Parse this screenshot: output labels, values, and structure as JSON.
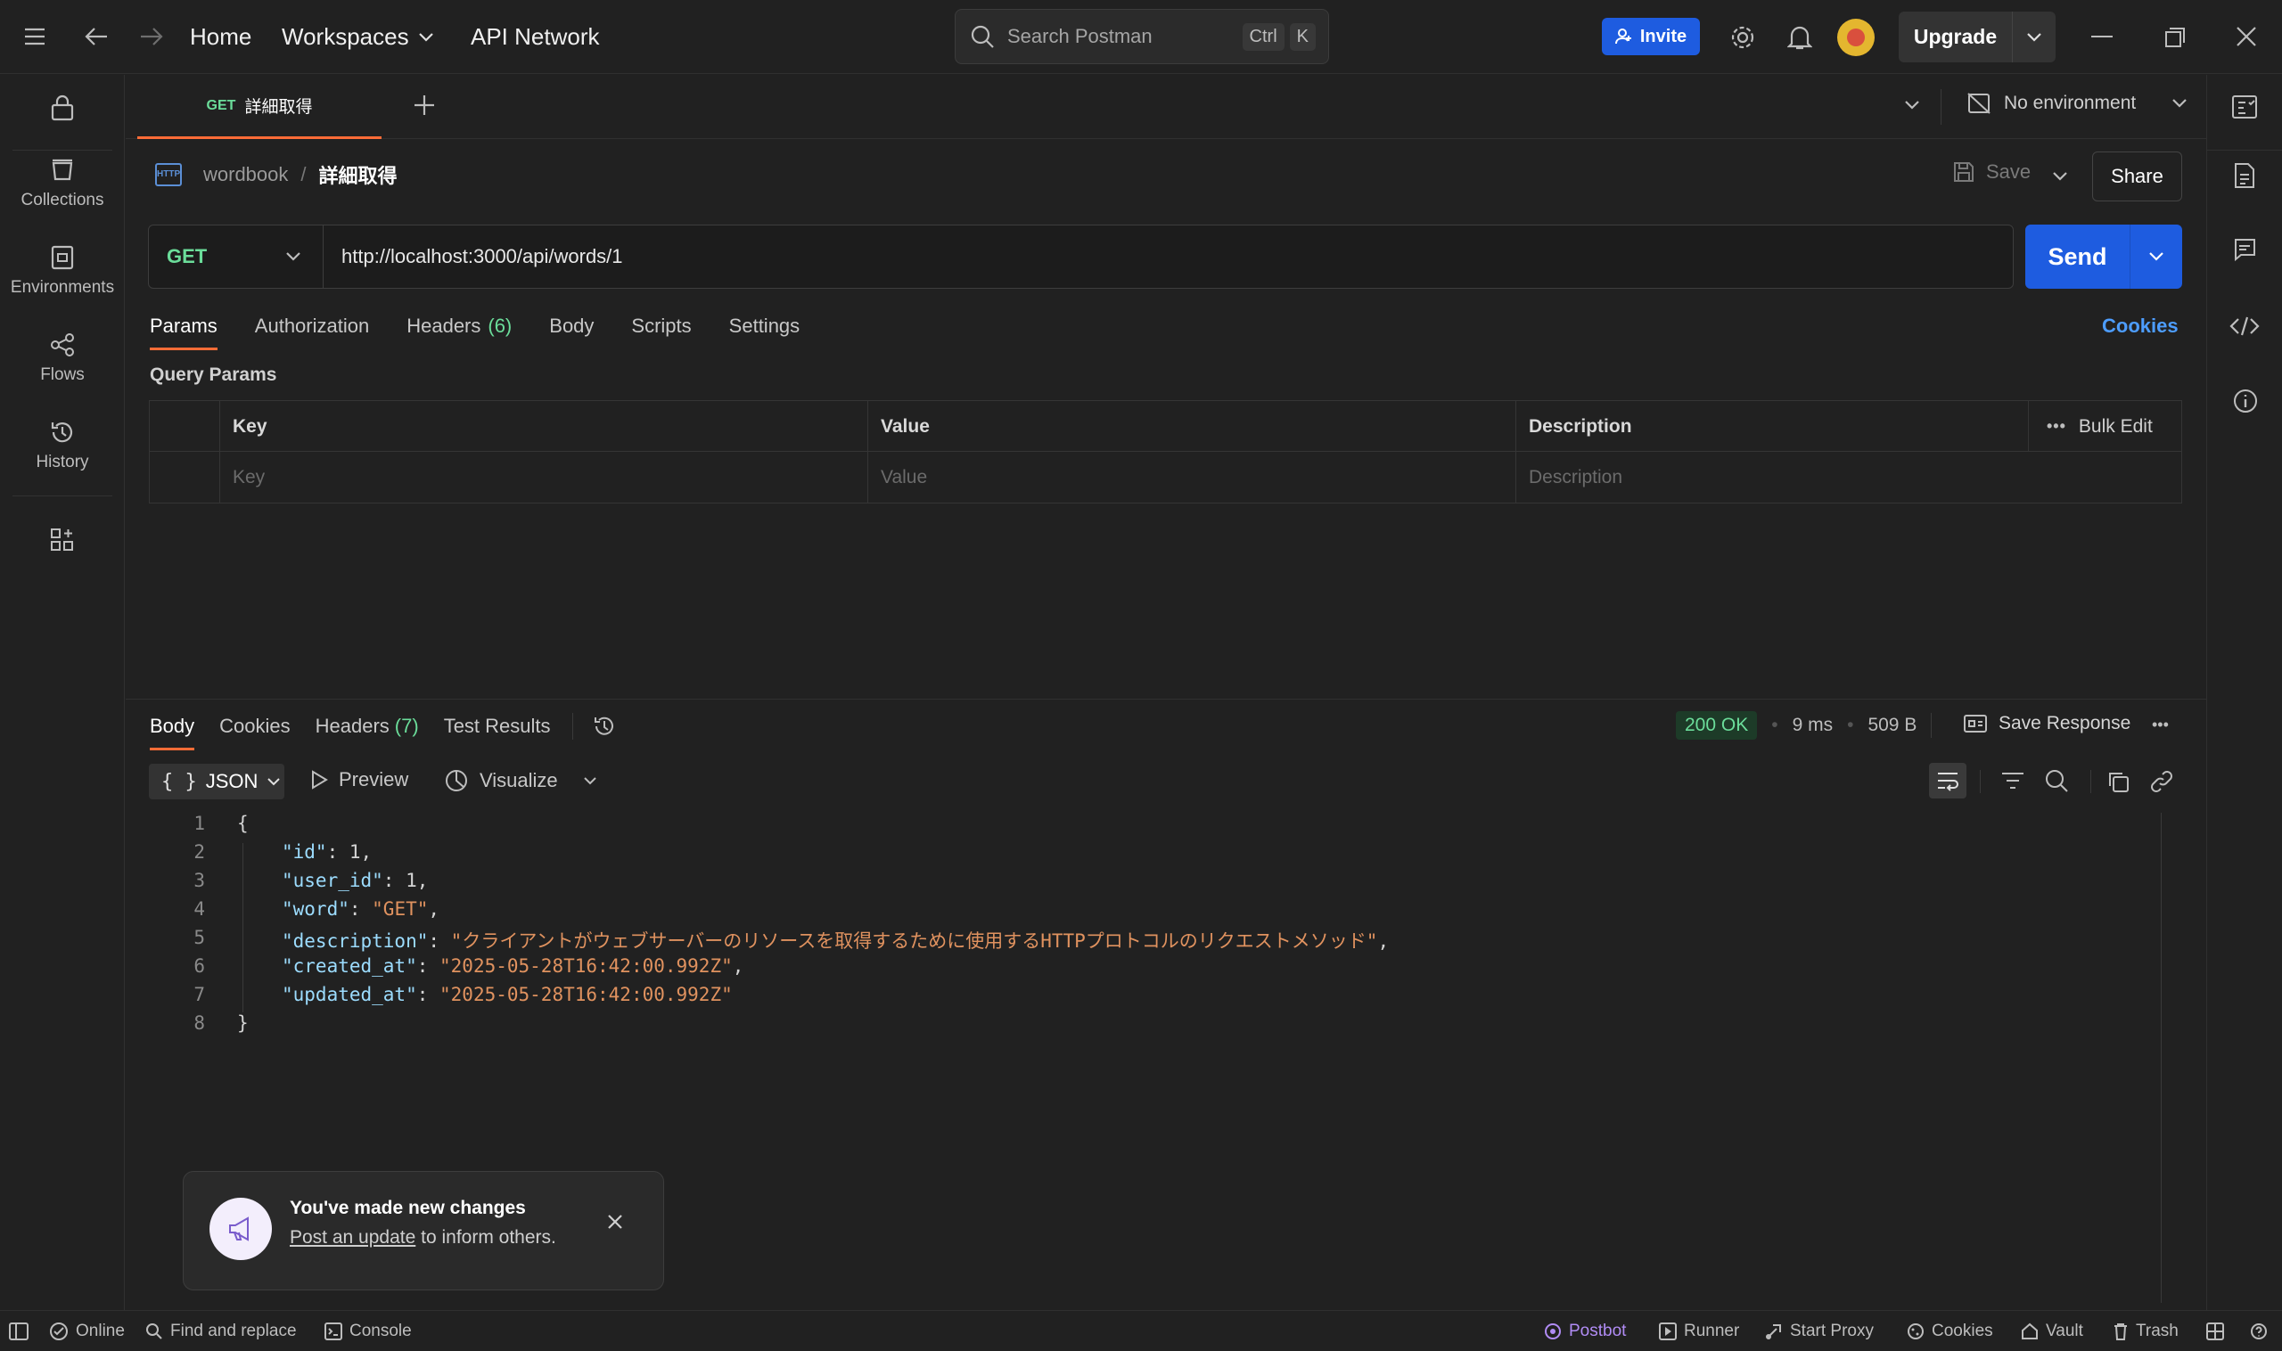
{
  "topbar": {
    "home": "Home",
    "workspaces": "Workspaces",
    "api_network": "API Network",
    "search_placeholder": "Search Postman",
    "kbd_ctrl": "Ctrl",
    "kbd_k": "K",
    "invite": "Invite",
    "upgrade": "Upgrade"
  },
  "sidebar": {
    "items": [
      {
        "label": "Collections",
        "icon": "collections-icon"
      },
      {
        "label": "Environments",
        "icon": "environments-icon"
      },
      {
        "label": "Flows",
        "icon": "flows-icon"
      },
      {
        "label": "History",
        "icon": "history-icon"
      }
    ]
  },
  "tab": {
    "method": "GET",
    "name": "詳細取得"
  },
  "environment": {
    "label": "No environment"
  },
  "breadcrumb": {
    "collection": "wordbook",
    "separator": "/",
    "request": "詳細取得"
  },
  "actions": {
    "save": "Save",
    "share": "Share"
  },
  "request": {
    "method": "GET",
    "url": "http://localhost:3000/api/words/1",
    "send": "Send"
  },
  "request_tabs": {
    "params": "Params",
    "authorization": "Authorization",
    "headers": "Headers",
    "headers_count": "(6)",
    "body": "Body",
    "scripts": "Scripts",
    "settings": "Settings",
    "cookies": "Cookies"
  },
  "query_params": {
    "title": "Query Params",
    "columns": {
      "key": "Key",
      "value": "Value",
      "description": "Description",
      "bulk_edit": "Bulk Edit"
    },
    "placeholders": {
      "key": "Key",
      "value": "Value",
      "description": "Description"
    }
  },
  "response": {
    "tabs": {
      "body": "Body",
      "cookies": "Cookies",
      "headers": "Headers",
      "headers_count": "(7)",
      "test_results": "Test Results"
    },
    "status": "200 OK",
    "time": "9 ms",
    "size": "509 B",
    "save_response": "Save Response",
    "format": "JSON",
    "preview": "Preview",
    "visualize": "Visualize",
    "line_numbers": [
      "1",
      "2",
      "3",
      "4",
      "5",
      "6",
      "7",
      "8"
    ],
    "json": {
      "open": "{",
      "id_key": "\"id\"",
      "id_val": "1",
      "user_id_key": "\"user_id\"",
      "user_id_val": "1",
      "word_key": "\"word\"",
      "word_val": "\"GET\"",
      "description_key": "\"description\"",
      "description_val": "\"クライアントがウェブサーバーのリソースを取得するために使用するHTTPプロトコルのリクエストメソッド\"",
      "created_at_key": "\"created_at\"",
      "created_at_val": "\"2025-05-28T16:42:00.992Z\"",
      "updated_at_key": "\"updated_at\"",
      "updated_at_val": "\"2025-05-28T16:42:00.992Z\"",
      "close": "}"
    }
  },
  "toast": {
    "title": "You've made new changes",
    "link": "Post an update",
    "rest": "to inform others."
  },
  "footer": {
    "online": "Online",
    "find_replace": "Find and replace",
    "console": "Console",
    "postbot": "Postbot",
    "runner": "Runner",
    "start_proxy": "Start Proxy",
    "cookies": "Cookies",
    "vault": "Vault",
    "trash": "Trash"
  },
  "colors": {
    "accent": "#ff6c37",
    "primary": "#1e5ce0",
    "success": "#6bdd9a",
    "json_key": "#9cdcfe",
    "json_string": "#e0925f"
  }
}
